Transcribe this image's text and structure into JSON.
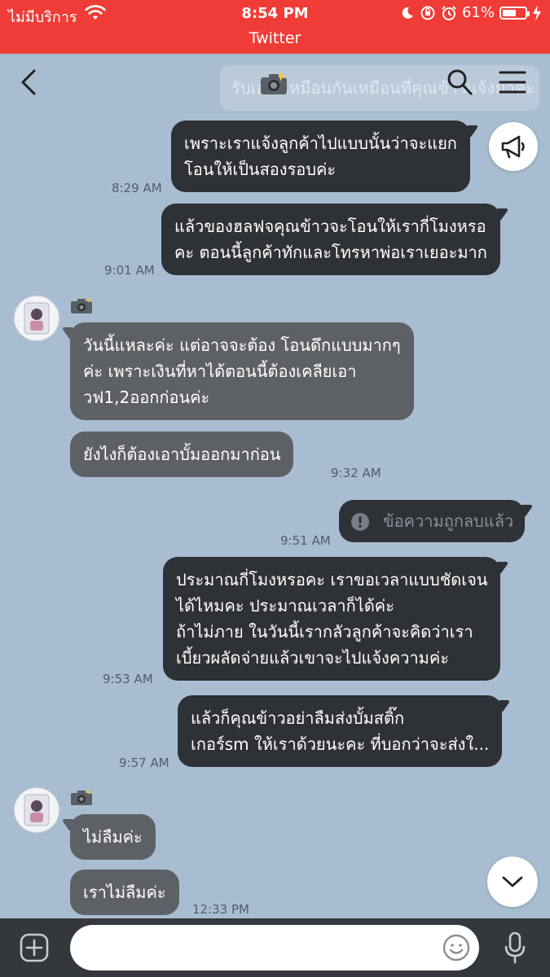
{
  "status_bar": {
    "carrier": "ไม่มีบริการ",
    "time": "8:54 PM",
    "battery": "61%",
    "battery_level": 0.61,
    "app_return": "Twitter"
  },
  "header": {
    "pinned_message": "รับเองก็เหมือนกันเหมือนที่คุณข้าวแจ้งมาค่ะ"
  },
  "colors": {
    "status_bar_bg": "#ef3c37",
    "chat_bg": "#a8bdd1",
    "sent_bubble": "#2e3236",
    "received_bubble": "#5d6166"
  },
  "messages": [
    {
      "side": "sent",
      "lines": [
        "เพราะเราแจ้งลูกค้าไปแบบนั้นว่าจะแยก",
        "โอนให้เป็นสองรอบค่ะ"
      ],
      "time": "8:29 AM"
    },
    {
      "side": "sent",
      "lines": [
        "แล้วของฮลฟจคุณข้าวจะโอนให้เรากี่โมงหรอ",
        "คะ ตอนนี้ลูกค้าทักและโทรหาพ่อเราเยอะมาก"
      ],
      "time": "9:01 AM"
    },
    {
      "side": "received",
      "lines": [
        "วันนี้แหละค่ะ แต่อาจจะต้อง โอนดึกแบบมากๆ",
        "ค่ะ เพราะเงินที่หาได้ตอนนี้ต้องเคลียเอา",
        "วฟ1,2ออกก่อนค่ะ"
      ]
    },
    {
      "side": "received",
      "lines": [
        "ยังไงก็ต้องเอาบั้มออกมาก่อน"
      ],
      "time": "9:32 AM"
    },
    {
      "side": "deleted",
      "text": "ข้อความถูกลบแล้ว",
      "time": "9:51 AM"
    },
    {
      "side": "sent",
      "lines": [
        "ประมาณกี่โมงหรอคะ เราขอเวลาแบบชัดเจน",
        "ได้ไหมคะ ประมาณเวลาก็ได้ค่ะ",
        "ถ้าไม่ภาย ในวันนี้เรากลัวลูกค้าจะคิดว่าเรา",
        "เบี้ยวผลัดจ่ายแล้วเขาจะไปแจ้งความค่ะ"
      ],
      "time": "9:53 AM"
    },
    {
      "side": "sent",
      "lines": [
        "แล้วก็คุณข้าวอย่าลืมส่งบั้มสติ๊ก",
        "เกอร์sm ให้เราด้วยนะคะ ที่บอกว่าจะส่งใ..."
      ],
      "time": "9:57 AM"
    },
    {
      "side": "received",
      "lines": [
        "ไม่ลืมค่ะ"
      ]
    },
    {
      "side": "received",
      "lines": [
        "เราไม่ลืมค่ะ"
      ],
      "time": "12:33 PM"
    }
  ],
  "input": {
    "placeholder": "",
    "value": ""
  }
}
